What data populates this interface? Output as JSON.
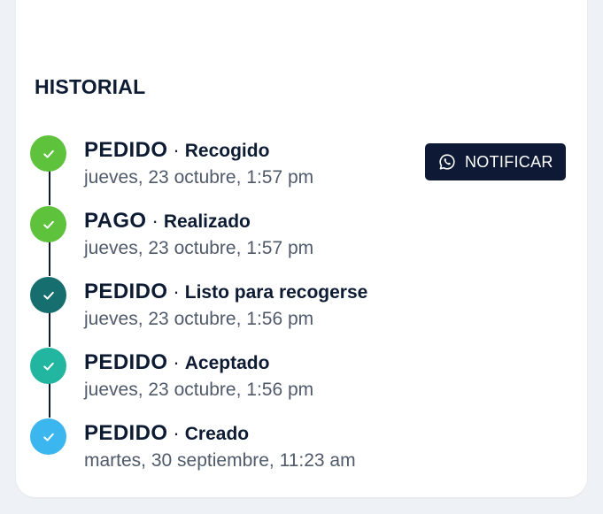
{
  "historial": {
    "title": "HISTORIAL",
    "events": [
      {
        "type": "PEDIDO",
        "separator": "·",
        "status": "Recogido",
        "date": "jueves, 23 octubre, 1:57 pm",
        "color": "#5fc23c"
      },
      {
        "type": "PAGO",
        "separator": "·",
        "status": "Realizado",
        "date": "jueves, 23 octubre, 1:57 pm",
        "color": "#5fc23c"
      },
      {
        "type": "PEDIDO",
        "separator": "·",
        "status": "Listo para recogerse",
        "date": "jueves, 23 octubre, 1:56 pm",
        "color": "#176e6e"
      },
      {
        "type": "PEDIDO",
        "separator": "·",
        "status": "Aceptado",
        "date": "jueves, 23 octubre, 1:56 pm",
        "color": "#22b6a0"
      },
      {
        "type": "PEDIDO",
        "separator": "·",
        "status": "Creado",
        "date": "martes, 30 septiembre, 11:23 am",
        "color": "#3bb6ef"
      }
    ],
    "notify_button": {
      "label": "NOTIFICAR",
      "icon": "whatsapp-icon",
      "color": "#0e1a35"
    }
  },
  "colors": {
    "background": "#eef1f5",
    "card": "#ffffff",
    "text_primary": "#0d1b33",
    "text_secondary": "#505a6a",
    "timeline_line": "#0d1b33"
  }
}
